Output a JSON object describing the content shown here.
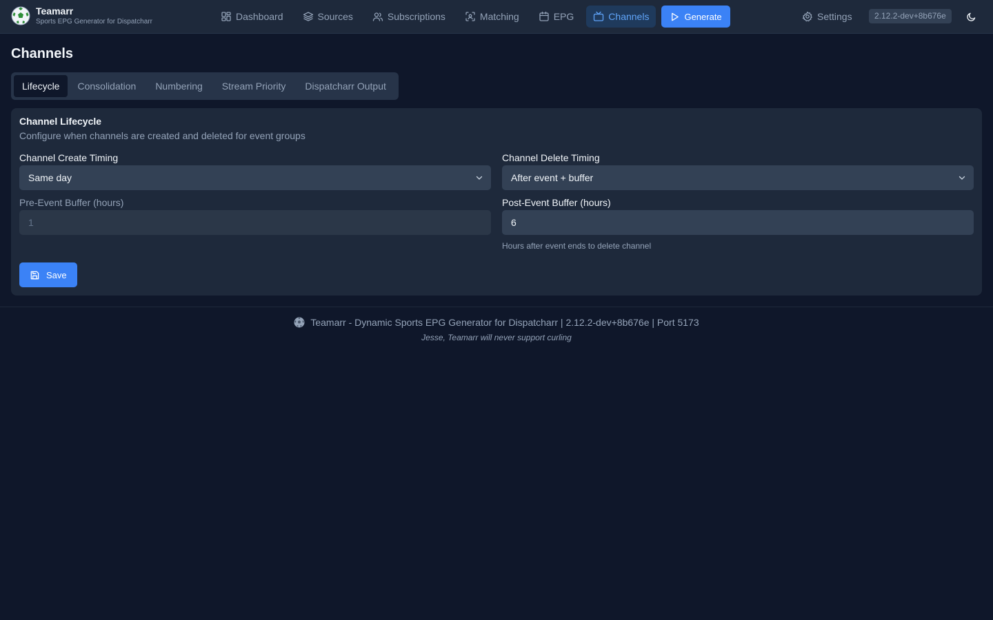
{
  "app": {
    "title": "Teamarr",
    "subtitle": "Sports EPG Generator for Dispatcharr",
    "version": "2.12.2-dev+8b676e"
  },
  "nav": {
    "items": [
      {
        "label": "Dashboard",
        "icon": "dashboard-icon"
      },
      {
        "label": "Sources",
        "icon": "layers-icon"
      },
      {
        "label": "Subscriptions",
        "icon": "users-icon"
      },
      {
        "label": "Matching",
        "icon": "scan-icon"
      },
      {
        "label": "EPG",
        "icon": "calendar-icon"
      },
      {
        "label": "Channels",
        "icon": "tv-icon",
        "active": true
      }
    ],
    "generate_label": "Generate",
    "settings_label": "Settings"
  },
  "page": {
    "title": "Channels",
    "tabs": [
      {
        "label": "Lifecycle",
        "active": true
      },
      {
        "label": "Consolidation"
      },
      {
        "label": "Numbering"
      },
      {
        "label": "Stream Priority"
      },
      {
        "label": "Dispatcharr Output"
      }
    ]
  },
  "lifecycle": {
    "title": "Channel Lifecycle",
    "description": "Configure when channels are created and deleted for event groups",
    "create_timing_label": "Channel Create Timing",
    "create_timing_value": "Same day",
    "delete_timing_label": "Channel Delete Timing",
    "delete_timing_value": "After event + buffer",
    "pre_buffer_label": "Pre-Event Buffer (hours)",
    "pre_buffer_value": "1",
    "post_buffer_label": "Post-Event Buffer (hours)",
    "post_buffer_value": "6",
    "post_buffer_hint": "Hours after event ends to delete channel",
    "save_label": "Save"
  },
  "footer": {
    "text": "Teamarr - Dynamic Sports EPG Generator for Dispatcharr | 2.12.2-dev+8b676e | Port 5173",
    "quote": "Jesse, Teamarr will never support curling"
  },
  "colors": {
    "background": "#0f172a",
    "surface": "#1e293b",
    "accent": "#3b82f6",
    "active_nav_text": "#60a5fa"
  }
}
